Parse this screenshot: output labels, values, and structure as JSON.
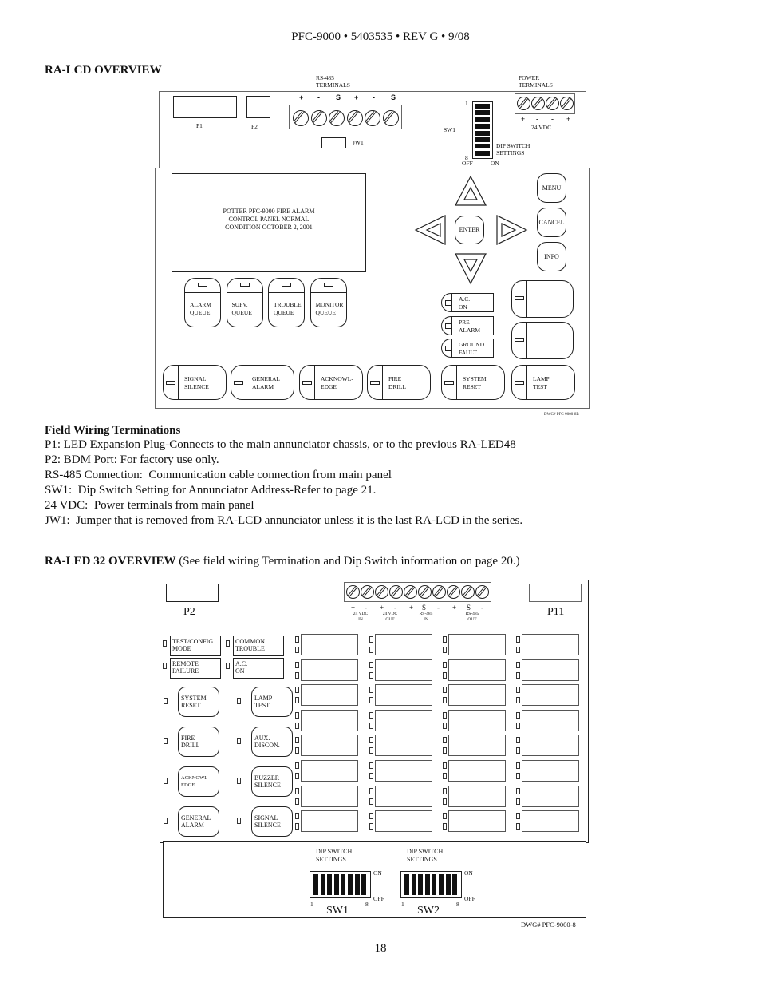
{
  "header": {
    "title": "PFC-9000 • 5403535 • REV G • 9/08"
  },
  "ra_lcd": {
    "section_title": "RA-LCD OVERVIEW",
    "top_board": {
      "rs485_label_1": "RS-485",
      "rs485_label_2": "TERMINALS",
      "rs485_pins": [
        "+",
        "-",
        "S",
        "+",
        "-",
        "S"
      ],
      "p1_label": "P1",
      "p2_label": "P2",
      "jw1_label": "JW1",
      "power_label_1": "POWER",
      "power_label_2": "TERMINALS",
      "power_pins": [
        "+",
        "-",
        "-",
        "+"
      ],
      "power_voltage": "24 VDC",
      "sw1_label": "SW1",
      "sw1_pos_1": "1",
      "sw1_pos_8": "8",
      "sw1_off": "OFF",
      "sw1_on": "ON",
      "dip_label_1": "DIP SWITCH",
      "dip_label_2": "SETTINGS"
    },
    "display": {
      "line1": "POTTER PFC-9000 FIRE ALARM",
      "line2": "CONTROL PANEL NORMAL",
      "line3": "CONDITION OCTOBER 2, 2001"
    },
    "nav": {
      "enter": "ENTER",
      "menu": "MENU",
      "cancel": "CANCEL",
      "info": "INFO"
    },
    "queue_buttons": [
      {
        "l1": "ALARM",
        "l2": "QUEUE"
      },
      {
        "l1": "SUPV.",
        "l2": "QUEUE"
      },
      {
        "l1": "TROUBLE",
        "l2": "QUEUE"
      },
      {
        "l1": "MONITOR",
        "l2": "QUEUE"
      }
    ],
    "status_leds": [
      {
        "l1": "A.C.",
        "l2": "ON"
      },
      {
        "l1": "PRE-",
        "l2": "ALARM"
      },
      {
        "l1": "GROUND",
        "l2": "FAULT"
      }
    ],
    "function_buttons": [
      {
        "l1": "SIGNAL",
        "l2": "SILENCE"
      },
      {
        "l1": "GENERAL",
        "l2": "ALARM"
      },
      {
        "l1": "ACKNOWL-",
        "l2": "EDGE"
      },
      {
        "l1": "FIRE",
        "l2": "DRILL"
      },
      {
        "l1": "SYSTEM",
        "l2": "RESET"
      },
      {
        "l1": "LAMP",
        "l2": "TEST"
      }
    ],
    "drawing_number": "DWG# PFC-9000-8B"
  },
  "field_wiring": {
    "title": "Field Wiring Terminations",
    "lines": [
      "P1: LED Expansion Plug-Connects to the main annunciator chassis, or to the previous RA-LED48",
      "P2: BDM Port: For factory use only.",
      "RS-485 Connection:  Communication cable connection from main panel",
      "SW1:  Dip Switch Setting for Annunciator Address-Refer to page 21.",
      "24 VDC:  Power terminals from main panel",
      "JW1:  Jumper that is removed from RA-LCD annunciator unless it is the last RA-LCD in the series."
    ]
  },
  "ra_led32": {
    "section_title": "RA-LED 32 OVERVIEW",
    "section_note": " (See field wiring Termination and Dip Switch information on page 20.)",
    "p2_label": "P2",
    "p11_label": "P11",
    "terminal_pins": [
      "+",
      "-",
      "+",
      "-",
      "+",
      "S",
      "-",
      "+",
      "S",
      "-"
    ],
    "terminal_groups": [
      {
        "l1": "24 VDC",
        "l2": "IN"
      },
      {
        "l1": "24 VDC",
        "l2": "OUT"
      },
      {
        "l1": "RS-485",
        "l2": "IN"
      },
      {
        "l1": "RS-485",
        "l2": "OUT"
      }
    ],
    "label_leds": [
      {
        "l1": "TEST/CONFIG",
        "l2": "MODE"
      },
      {
        "l1": "COMMON",
        "l2": "TROUBLE"
      },
      {
        "l1": "REMOTE",
        "l2": "FAILURE"
      },
      {
        "l1": "A.C.",
        "l2": "ON"
      }
    ],
    "buttons_left": [
      {
        "l1": "SYSTEM",
        "l2": "RESET"
      },
      {
        "l1": "FIRE",
        "l2": "DRILL"
      },
      {
        "l1": "ACKNOWL-",
        "l2": "EDGE"
      },
      {
        "l1": "GENERAL",
        "l2": "ALARM"
      }
    ],
    "buttons_right": [
      {
        "l1": "LAMP",
        "l2": "TEST"
      },
      {
        "l1": "AUX.",
        "l2": "DISCON."
      },
      {
        "l1": "BUZZER",
        "l2": "SILENCE"
      },
      {
        "l1": "SIGNAL",
        "l2": "SILENCE"
      }
    ],
    "zone_columns": 4,
    "zone_rows": 8,
    "dip": {
      "label_1": "DIP SWITCH",
      "label_2": "SETTINGS",
      "on": "ON",
      "off": "OFF",
      "pos_1": "1",
      "pos_8": "8",
      "sw1": "SW1",
      "sw2": "SW2"
    },
    "drawing_number": "DWG# PFC-9000-8"
  },
  "footer": {
    "page_number": "18"
  }
}
